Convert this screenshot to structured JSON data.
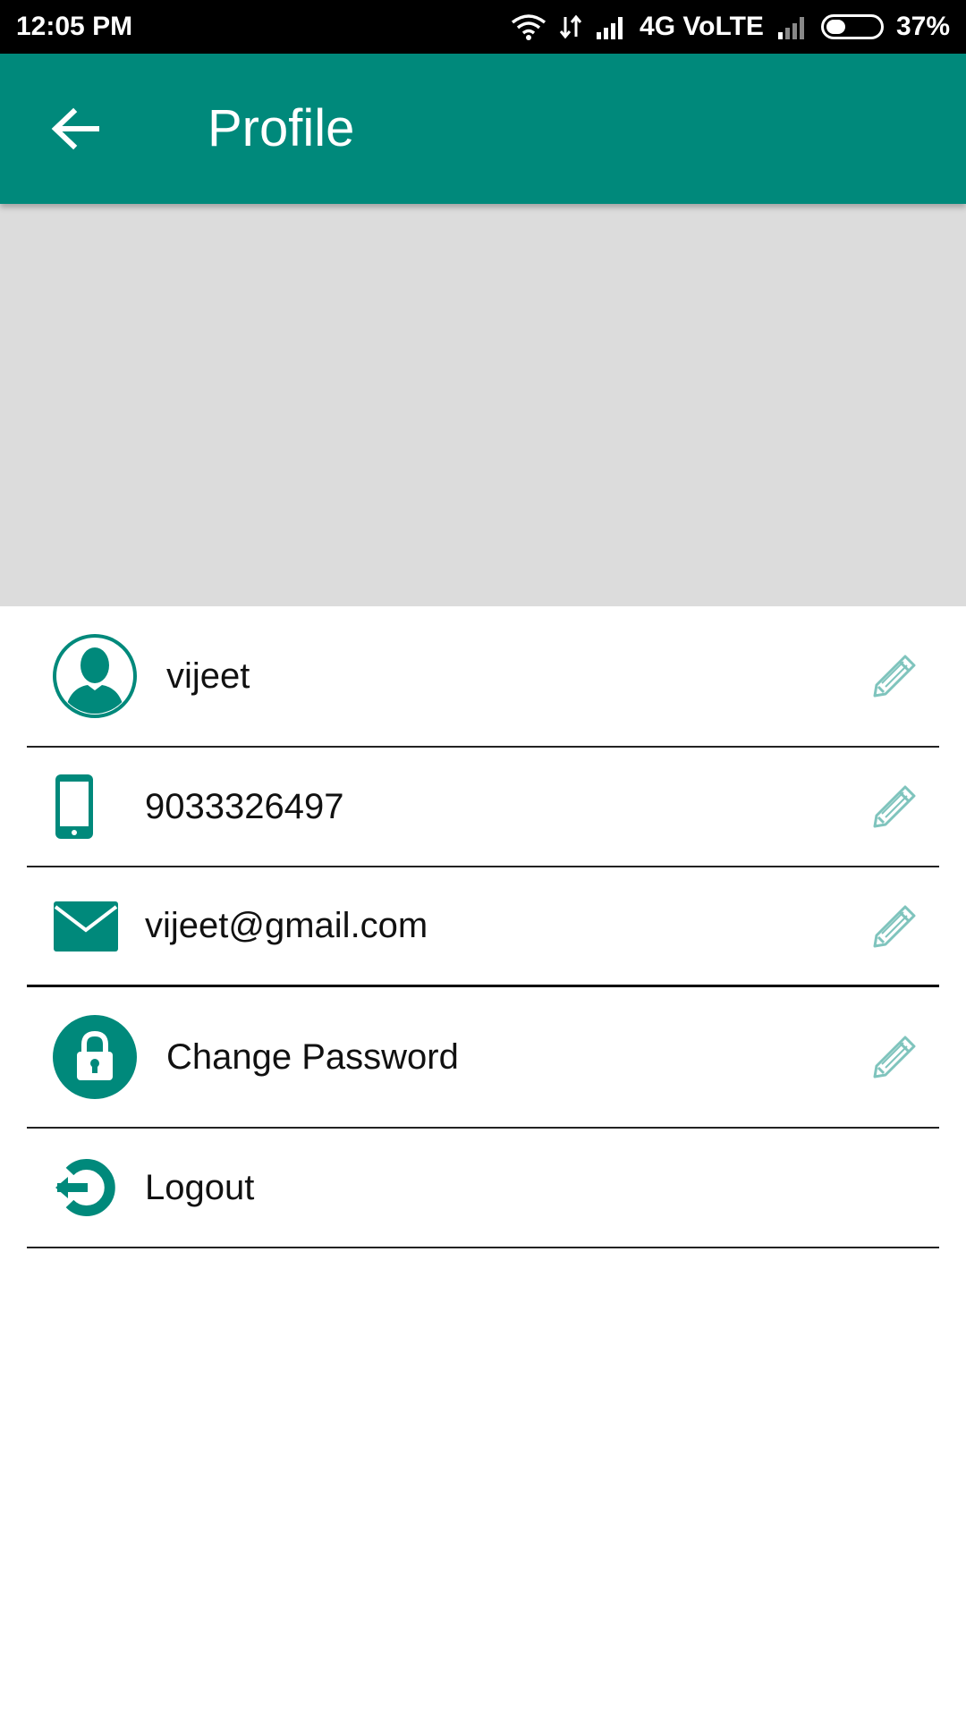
{
  "status_bar": {
    "time": "12:05 PM",
    "network": "4G VoLTE",
    "battery": "37%",
    "battery_level": 0.37
  },
  "app_bar": {
    "title": "Profile",
    "back_icon": "arrow-back-icon"
  },
  "profile": {
    "name": "vijeet",
    "phone": "9033326497",
    "email": "vijeet@gmail.com",
    "change_password_label": "Change Password",
    "logout_label": "Logout"
  },
  "icons": {
    "avatar": "person-icon",
    "phone": "smartphone-icon",
    "email": "envelope-icon",
    "lock": "lock-icon",
    "logout": "logout-icon",
    "edit": "pencil-icon"
  },
  "colors": {
    "primary": "#00897b",
    "edit_icon": "#7fc4bd",
    "cover": "#dcdcdc",
    "divider": "#222222"
  }
}
